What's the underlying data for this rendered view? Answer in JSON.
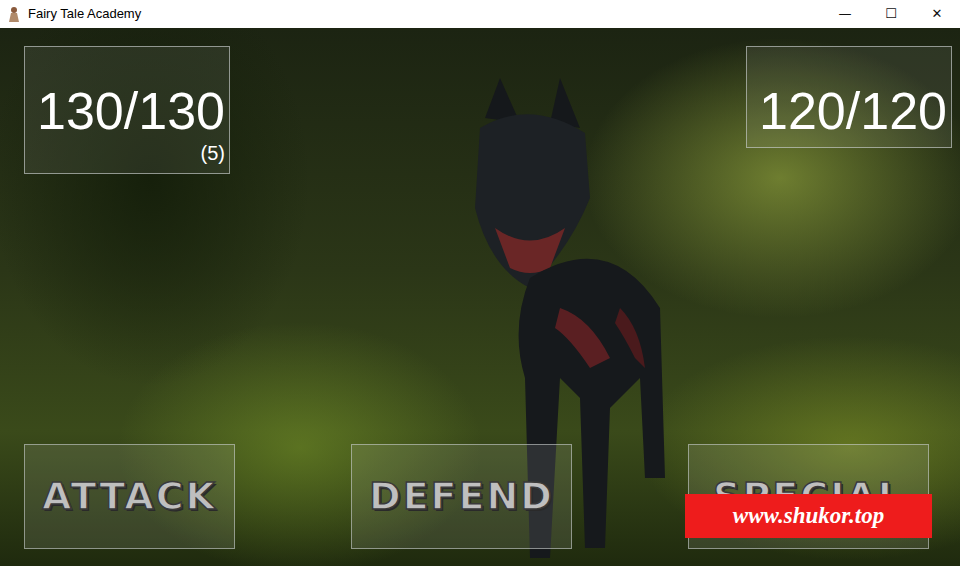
{
  "window": {
    "title": "Fairy Tale Academy",
    "controls": [
      "—",
      "☐",
      "✕"
    ]
  },
  "player": {
    "hp": "130/130",
    "counter": "(5)"
  },
  "enemy": {
    "hp": "120/120"
  },
  "actions": [
    {
      "label": "ATTACK"
    },
    {
      "label": "DEFEND"
    },
    {
      "label": "SPECIAL"
    }
  ],
  "watermark": "www.shukor.top"
}
